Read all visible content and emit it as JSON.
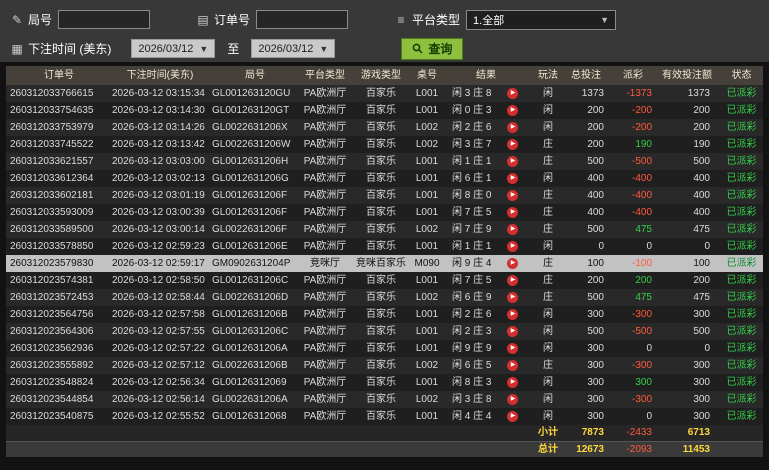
{
  "icons": {
    "round": "✎",
    "order": "▤",
    "platform": "≡",
    "calendar": "▦",
    "dropdown_arrow": "▼",
    "play": "▶"
  },
  "colors": {
    "accent_green": "#8fbf3f",
    "negative_red": "#ff5a3c",
    "positive_green": "#35d04b",
    "highlight_yellow": "#ffd83d",
    "status_green": "#35d04b"
  },
  "filters": {
    "round_label": "局号",
    "round_value": "",
    "order_label": "订单号",
    "order_value": "",
    "platform_label": "平台类型",
    "platform_value": "1.全部",
    "time_label": "下注时间 (美东)",
    "date_from": "2026/03/12",
    "to_label": "至",
    "date_to": "2026/03/12",
    "query_label": "查询"
  },
  "table": {
    "headers": [
      "订单号",
      "下注时间(美东)",
      "局号",
      "平台类型",
      "游戏类型",
      "桌号",
      "结果",
      "玩法",
      "总投注",
      "派彩",
      "有效投注额",
      "状态"
    ],
    "rows": [
      {
        "order": "260312033766615",
        "time": "2026-03-12 03:15:34",
        "round": "GL001263120GU",
        "platform": "PA欧洲厅",
        "game": "百家乐",
        "table_no": "L001",
        "result": "闲 3 庄 8",
        "play": "闲",
        "bet": 1373,
        "payout": -1373,
        "valid": 1373,
        "status": "已派彩"
      },
      {
        "order": "260312033754635",
        "time": "2026-03-12 03:14:30",
        "round": "GL001263120GT",
        "platform": "PA欧洲厅",
        "game": "百家乐",
        "table_no": "L001",
        "result": "闲 0 庄 3",
        "play": "闲",
        "bet": 200,
        "payout": -200,
        "valid": 200,
        "status": "已派彩"
      },
      {
        "order": "260312033753979",
        "time": "2026-03-12 03:14:26",
        "round": "GL0022631206X",
        "platform": "PA欧洲厅",
        "game": "百家乐",
        "table_no": "L002",
        "result": "闲 2 庄 6",
        "play": "闲",
        "bet": 200,
        "payout": -200,
        "valid": 200,
        "status": "已派彩"
      },
      {
        "order": "260312033745522",
        "time": "2026-03-12 03:13:42",
        "round": "GL0022631206W",
        "platform": "PA欧洲厅",
        "game": "百家乐",
        "table_no": "L002",
        "result": "闲 3 庄 7",
        "play": "庄",
        "bet": 200,
        "payout": 190,
        "valid": 190,
        "status": "已派彩"
      },
      {
        "order": "260312033621557",
        "time": "2026-03-12 03:03:00",
        "round": "GL0012631206H",
        "platform": "PA欧洲厅",
        "game": "百家乐",
        "table_no": "L001",
        "result": "闲 1 庄 1",
        "play": "庄",
        "bet": 500,
        "payout": -500,
        "valid": 500,
        "status": "已派彩"
      },
      {
        "order": "260312033612364",
        "time": "2026-03-12 03:02:13",
        "round": "GL0012631206G",
        "platform": "PA欧洲厅",
        "game": "百家乐",
        "table_no": "L001",
        "result": "闲 6 庄 1",
        "play": "闲",
        "bet": 400,
        "payout": -400,
        "valid": 400,
        "status": "已派彩"
      },
      {
        "order": "260312033602181",
        "time": "2026-03-12 03:01:19",
        "round": "GL0012631206F",
        "platform": "PA欧洲厅",
        "game": "百家乐",
        "table_no": "L001",
        "result": "闲 8 庄 0",
        "play": "庄",
        "bet": 400,
        "payout": -400,
        "valid": 400,
        "status": "已派彩"
      },
      {
        "order": "260312033593009",
        "time": "2026-03-12 03:00:39",
        "round": "GL0012631206F",
        "platform": "PA欧洲厅",
        "game": "百家乐",
        "table_no": "L001",
        "result": "闲 7 庄 5",
        "play": "庄",
        "bet": 400,
        "payout": -400,
        "valid": 400,
        "status": "已派彩"
      },
      {
        "order": "260312033589500",
        "time": "2026-03-12 03:00:14",
        "round": "GL0022631206F",
        "platform": "PA欧洲厅",
        "game": "百家乐",
        "table_no": "L002",
        "result": "闲 7 庄 9",
        "play": "庄",
        "bet": 500,
        "payout": 475,
        "valid": 475,
        "status": "已派彩"
      },
      {
        "order": "260312033578850",
        "time": "2026-03-12 02:59:23",
        "round": "GL0012631206E",
        "platform": "PA欧洲厅",
        "game": "百家乐",
        "table_no": "L001",
        "result": "闲 1 庄 1",
        "play": "闲",
        "bet": 0,
        "payout": 0,
        "valid": 0,
        "status": "已派彩"
      },
      {
        "order": "260312023579830",
        "time": "2026-03-12 02:59:17",
        "round": "GM0902631204P",
        "platform": "竞咪厅",
        "game": "竞咪百家乐",
        "table_no": "M090",
        "result": "闲 9 庄 4",
        "play": "庄",
        "bet": 100,
        "payout": -100,
        "valid": 100,
        "status": "已派彩",
        "selected": true
      },
      {
        "order": "260312023574381",
        "time": "2026-03-12 02:58:50",
        "round": "GL0012631206C",
        "platform": "PA欧洲厅",
        "game": "百家乐",
        "table_no": "L001",
        "result": "闲 7 庄 5",
        "play": "庄",
        "bet": 200,
        "payout": 200,
        "valid": 200,
        "status": "已派彩"
      },
      {
        "order": "260312023572453",
        "time": "2026-03-12 02:58:44",
        "round": "GL0022631206D",
        "platform": "PA欧洲厅",
        "game": "百家乐",
        "table_no": "L002",
        "result": "闲 6 庄 9",
        "play": "庄",
        "bet": 500,
        "payout": 475,
        "valid": 475,
        "status": "已派彩"
      },
      {
        "order": "260312023564756",
        "time": "2026-03-12 02:57:58",
        "round": "GL0012631206B",
        "platform": "PA欧洲厅",
        "game": "百家乐",
        "table_no": "L001",
        "result": "闲 2 庄 6",
        "play": "闲",
        "bet": 300,
        "payout": -300,
        "valid": 300,
        "status": "已派彩"
      },
      {
        "order": "260312023564306",
        "time": "2026-03-12 02:57:55",
        "round": "GL0012631206C",
        "platform": "PA欧洲厅",
        "game": "百家乐",
        "table_no": "L001",
        "result": "闲 2 庄 3",
        "play": "闲",
        "bet": 500,
        "payout": -500,
        "valid": 500,
        "status": "已派彩"
      },
      {
        "order": "260312023562936",
        "time": "2026-03-12 02:57:22",
        "round": "GL0012631206A",
        "platform": "PA欧洲厅",
        "game": "百家乐",
        "table_no": "L001",
        "result": "闲 9 庄 9",
        "play": "闲",
        "bet": 300,
        "payout": 0,
        "valid": 0,
        "status": "已派彩"
      },
      {
        "order": "260312023555892",
        "time": "2026-03-12 02:57:12",
        "round": "GL0022631206B",
        "platform": "PA欧洲厅",
        "game": "百家乐",
        "table_no": "L002",
        "result": "闲 6 庄 5",
        "play": "庄",
        "bet": 300,
        "payout": -300,
        "valid": 300,
        "status": "已派彩"
      },
      {
        "order": "260312023548824",
        "time": "2026-03-12 02:56:34",
        "round": "GL00126312069",
        "platform": "PA欧洲厅",
        "game": "百家乐",
        "table_no": "L001",
        "result": "闲 8 庄 3",
        "play": "闲",
        "bet": 300,
        "payout": 300,
        "valid": 300,
        "status": "已派彩"
      },
      {
        "order": "260312023544854",
        "time": "2026-03-12 02:56:14",
        "round": "GL0022631206A",
        "platform": "PA欧洲厅",
        "game": "百家乐",
        "table_no": "L002",
        "result": "闲 3 庄 8",
        "play": "闲",
        "bet": 300,
        "payout": -300,
        "valid": 300,
        "status": "已派彩"
      },
      {
        "order": "260312023540875",
        "time": "2026-03-12 02:55:52",
        "round": "GL00126312068",
        "platform": "PA欧洲厅",
        "game": "百家乐",
        "table_no": "L001",
        "result": "闲 4 庄 4",
        "play": "闲",
        "bet": 300,
        "payout": 0,
        "valid": 300,
        "status": "已派彩"
      }
    ],
    "subtotal": {
      "label": "小计",
      "bet": "7873",
      "payout": "-2433",
      "valid": "6713"
    },
    "total": {
      "label": "总计",
      "bet": "12673",
      "payout": "-2093",
      "valid": "11453"
    }
  }
}
